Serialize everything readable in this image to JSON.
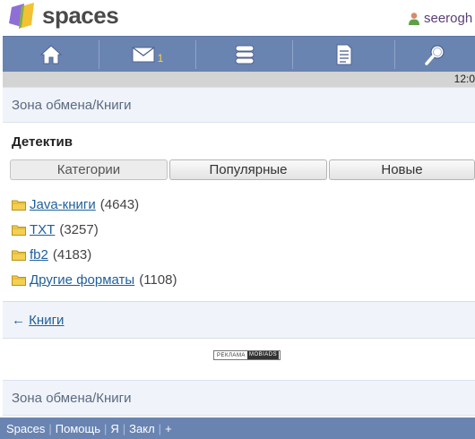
{
  "header": {
    "logo_text": "spaces",
    "user_name": "seerogh"
  },
  "nav": {
    "mail_count": "1",
    "icons": [
      "home-icon",
      "mail-icon",
      "chat-icon",
      "journal-icon",
      "search-icon"
    ]
  },
  "status": {
    "time": "12:0"
  },
  "breadcrumb_top": "Зона обмена/Книги",
  "section": {
    "title": "Детектив",
    "tabs": [
      "Категории",
      "Популярные",
      "Новые"
    ],
    "active_tab": "Категории"
  },
  "folders": [
    {
      "name": "Java-книги",
      "count": "(4643)"
    },
    {
      "name": "TXT",
      "count": "(3257)"
    },
    {
      "name": "fb2",
      "count": "(4183)"
    },
    {
      "name": "Другие форматы",
      "count": "(1108)"
    }
  ],
  "back": {
    "arrow": "←",
    "label": "Книги"
  },
  "ad": {
    "left": "РЕКЛАМА",
    "right": "MOBIADS"
  },
  "breadcrumb_bottom": "Зона обмена/Книги",
  "footer": {
    "links": [
      "Spaces",
      "Помощь",
      "Я",
      "Закл",
      "+"
    ],
    "separator": "|"
  },
  "colors": {
    "navbar": "#6a84b2",
    "link": "#1e5f9c",
    "crumb_bg": "#f0f3f9",
    "mail_count": "#ffd24a"
  }
}
